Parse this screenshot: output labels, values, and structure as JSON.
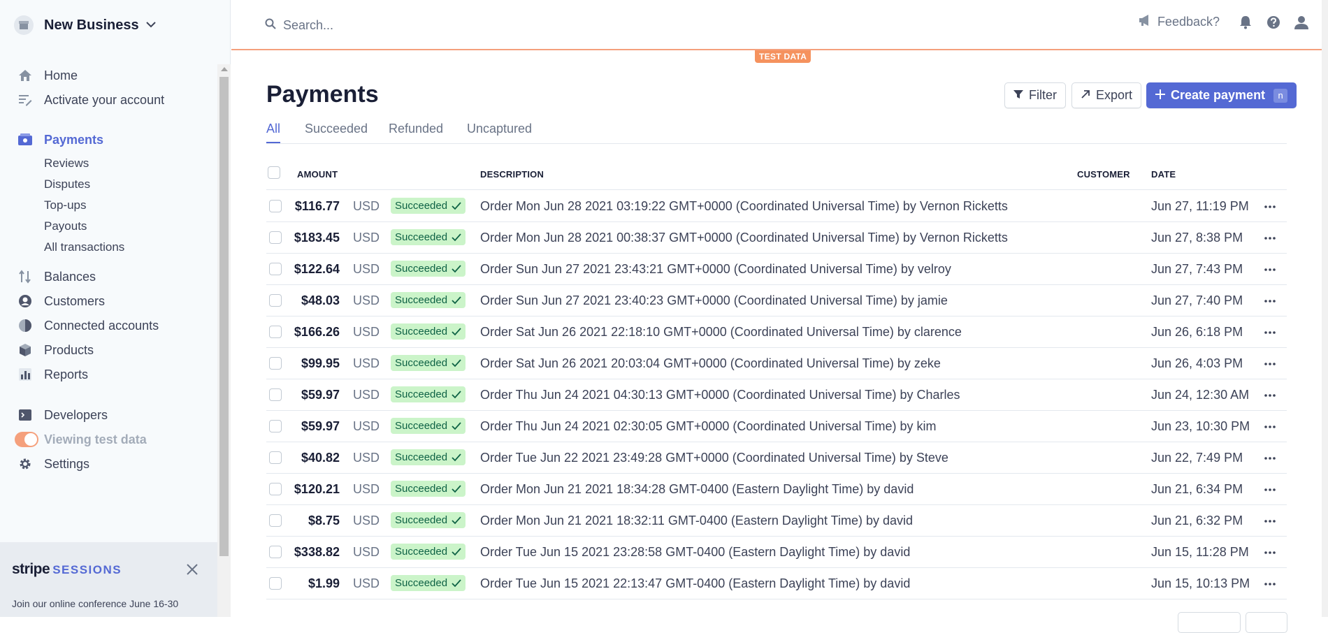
{
  "business": {
    "name": "New Business"
  },
  "nav": {
    "home": "Home",
    "activate": "Activate your account",
    "payments": "Payments",
    "payments_sub": [
      "Reviews",
      "Disputes",
      "Top-ups",
      "Payouts",
      "All transactions"
    ],
    "balances": "Balances",
    "customers": "Customers",
    "connected": "Connected accounts",
    "products": "Products",
    "reports": "Reports",
    "developers": "Developers",
    "viewing_test": "Viewing test data",
    "settings": "Settings"
  },
  "promo": {
    "brand": "stripe",
    "sessions": "SESSIONS",
    "text": "Join our online conference June 16-30"
  },
  "header": {
    "search_placeholder": "Search...",
    "feedback": "Feedback?",
    "test_badge": "TEST DATA"
  },
  "page": {
    "title": "Payments",
    "filter": "Filter",
    "export": "Export",
    "create": "Create payment",
    "create_kbd": "n",
    "tabs": [
      "All",
      "Succeeded",
      "Refunded",
      "Uncaptured"
    ]
  },
  "table": {
    "headers": {
      "amount": "AMOUNT",
      "description": "DESCRIPTION",
      "customer": "CUSTOMER",
      "date": "DATE"
    },
    "rows": [
      {
        "amount": "$116.77",
        "currency": "USD",
        "status": "Succeeded",
        "description": "Order Mon Jun 28 2021 03:19:22 GMT+0000 (Coordinated Universal Time) by Vernon Ricketts",
        "date": "Jun 27, 11:19 PM"
      },
      {
        "amount": "$183.45",
        "currency": "USD",
        "status": "Succeeded",
        "description": "Order Mon Jun 28 2021 00:38:37 GMT+0000 (Coordinated Universal Time) by Vernon Ricketts",
        "date": "Jun 27, 8:38 PM"
      },
      {
        "amount": "$122.64",
        "currency": "USD",
        "status": "Succeeded",
        "description": "Order Sun Jun 27 2021 23:43:21 GMT+0000 (Coordinated Universal Time) by velroy",
        "date": "Jun 27, 7:43 PM"
      },
      {
        "amount": "$48.03",
        "currency": "USD",
        "status": "Succeeded",
        "description": "Order Sun Jun 27 2021 23:40:23 GMT+0000 (Coordinated Universal Time) by jamie",
        "date": "Jun 27, 7:40 PM"
      },
      {
        "amount": "$166.26",
        "currency": "USD",
        "status": "Succeeded",
        "description": "Order Sat Jun 26 2021 22:18:10 GMT+0000 (Coordinated Universal Time) by clarence",
        "date": "Jun 26, 6:18 PM"
      },
      {
        "amount": "$99.95",
        "currency": "USD",
        "status": "Succeeded",
        "description": "Order Sat Jun 26 2021 20:03:04 GMT+0000 (Coordinated Universal Time) by zeke",
        "date": "Jun 26, 4:03 PM"
      },
      {
        "amount": "$59.97",
        "currency": "USD",
        "status": "Succeeded",
        "description": "Order Thu Jun 24 2021 04:30:13 GMT+0000 (Coordinated Universal Time) by Charles",
        "date": "Jun 24, 12:30 AM"
      },
      {
        "amount": "$59.97",
        "currency": "USD",
        "status": "Succeeded",
        "description": "Order Thu Jun 24 2021 02:30:05 GMT+0000 (Coordinated Universal Time) by kim",
        "date": "Jun 23, 10:30 PM"
      },
      {
        "amount": "$40.82",
        "currency": "USD",
        "status": "Succeeded",
        "description": "Order Tue Jun 22 2021 23:49:28 GMT+0000 (Coordinated Universal Time) by Steve",
        "date": "Jun 22, 7:49 PM"
      },
      {
        "amount": "$120.21",
        "currency": "USD",
        "status": "Succeeded",
        "description": "Order Mon Jun 21 2021 18:34:28 GMT-0400 (Eastern Daylight Time) by david",
        "date": "Jun 21, 6:34 PM"
      },
      {
        "amount": "$8.75",
        "currency": "USD",
        "status": "Succeeded",
        "description": "Order Mon Jun 21 2021 18:32:11 GMT-0400 (Eastern Daylight Time) by david",
        "date": "Jun 21, 6:32 PM"
      },
      {
        "amount": "$338.82",
        "currency": "USD",
        "status": "Succeeded",
        "description": "Order Tue Jun 15 2021 23:28:58 GMT-0400 (Eastern Daylight Time) by david",
        "date": "Jun 15, 11:28 PM"
      },
      {
        "amount": "$1.99",
        "currency": "USD",
        "status": "Succeeded",
        "description": "Order Tue Jun 15 2021 22:13:47 GMT-0400 (Eastern Daylight Time) by david",
        "date": "Jun 15, 10:13 PM"
      }
    ]
  },
  "colors": {
    "accent": "#5469d4",
    "test_orange": "#f5925e",
    "success_bg": "#cbf4c9",
    "success_text": "#0e6245"
  }
}
